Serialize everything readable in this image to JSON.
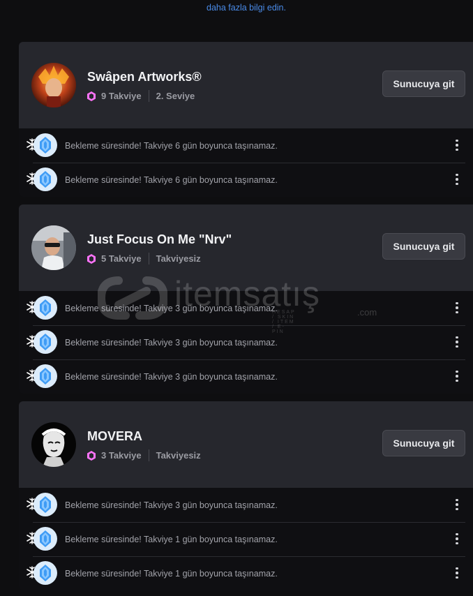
{
  "top": {
    "link_text": "daha fazla bilgi edin."
  },
  "servers": [
    {
      "name": "Swâpen Artworks®",
      "boost_count": "9 Takviye",
      "level": "2. Seviye",
      "button": "Sunucuya git",
      "rows": [
        {
          "text": "Bekleme süresinde! Takviye 6 gün boyunca taşınamaz."
        },
        {
          "text": "Bekleme süresinde! Takviye 6 gün boyunca taşınamaz."
        }
      ]
    },
    {
      "name": "Just Focus On Me \"Nrv\"",
      "boost_count": "5 Takviye",
      "level": "Takviyesiz",
      "button": "Sunucuya git",
      "rows": [
        {
          "text": "Bekleme süresinde! Takviye 3 gün boyunca taşınamaz."
        },
        {
          "text": "Bekleme süresinde! Takviye 3 gün boyunca taşınamaz."
        },
        {
          "text": "Bekleme süresinde! Takviye 3 gün boyunca taşınamaz."
        }
      ]
    },
    {
      "name": "MOVERA",
      "boost_count": "3 Takviye",
      "level": "Takviyesiz",
      "button": "Sunucuya git",
      "rows": [
        {
          "text": "Bekleme süresinde! Takviye 3 gün boyunca taşınamaz."
        },
        {
          "text": "Bekleme süresinde! Takviye 1 gün boyunca taşınamaz."
        },
        {
          "text": "Bekleme süresinde! Takviye 1 gün boyunca taşınamaz."
        }
      ]
    }
  ],
  "watermark": {
    "brand": "itemsatış",
    "tagline": "HESAP / SKIN / ITEM / E-PIN",
    "suffix": ".com"
  },
  "colors": {
    "accent_link": "#4a8be8",
    "boost_pink": "#ff73fa",
    "crystal_blue": "#3f9cf5"
  }
}
